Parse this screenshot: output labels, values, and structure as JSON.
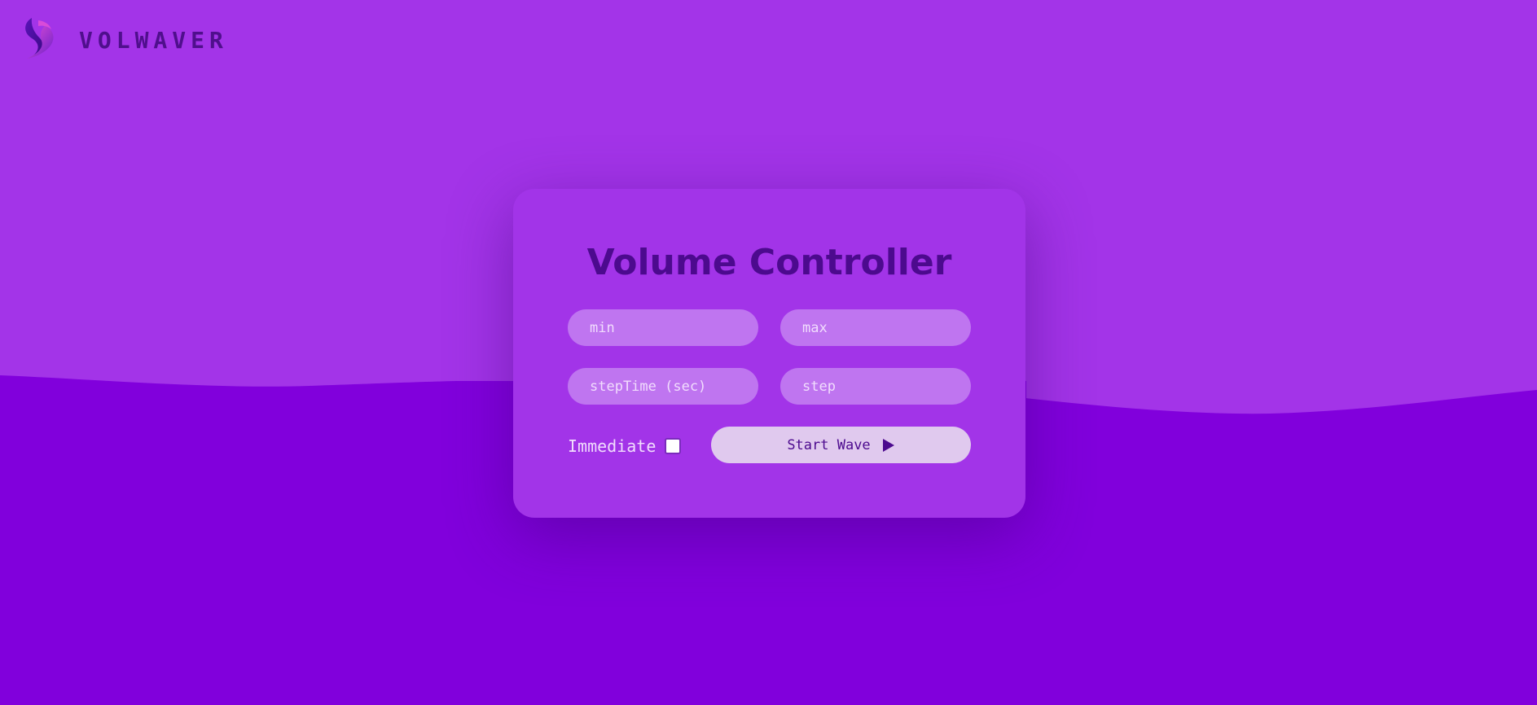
{
  "brand": {
    "name": "VOLWAVER",
    "logo_icon": "swirl-s-logo-icon"
  },
  "colors": {
    "background_top": "#a334e8",
    "background_wave": "#8100dc",
    "card": "#a234e8",
    "field": "#bf75f0",
    "title": "#4c0a8e",
    "button": "#e0c9ee"
  },
  "card": {
    "title": "Volume Controller",
    "fields": {
      "min": {
        "placeholder": "min",
        "value": ""
      },
      "max": {
        "placeholder": "max",
        "value": ""
      },
      "step_time": {
        "placeholder": "stepTime (sec)",
        "value": ""
      },
      "step": {
        "placeholder": "step",
        "value": ""
      }
    },
    "immediate": {
      "label": "Immediate",
      "checked": false
    },
    "start_button": {
      "label": "Start Wave",
      "icon": "play-icon"
    }
  }
}
